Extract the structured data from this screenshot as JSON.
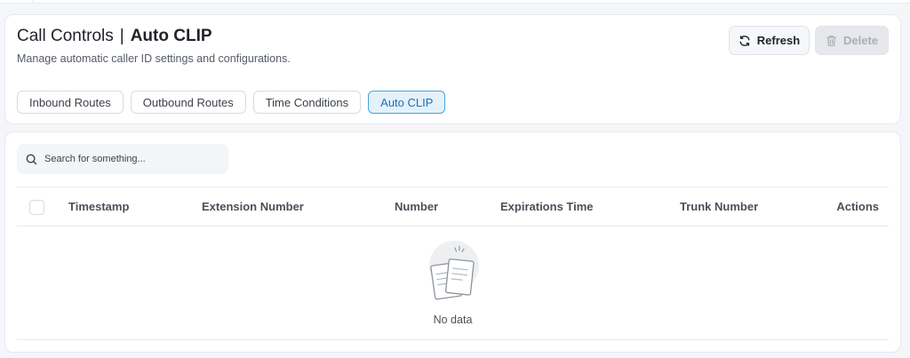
{
  "header": {
    "title": "Call Controls",
    "separator": "|",
    "subtitle": "Auto CLIP",
    "description": "Manage automatic caller ID settings and configurations."
  },
  "actions": {
    "refresh_label": "Refresh",
    "delete_label": "Delete",
    "refresh_icon": "refresh-icon",
    "delete_icon": "trash-icon"
  },
  "tabs": [
    {
      "label": "Inbound Routes",
      "active": false
    },
    {
      "label": "Outbound Routes",
      "active": false
    },
    {
      "label": "Time Conditions",
      "active": false
    },
    {
      "label": "Auto CLIP",
      "active": true
    }
  ],
  "search": {
    "placeholder": "Search for something...",
    "value": ""
  },
  "table": {
    "columns": [
      "Timestamp",
      "Extension Number",
      "Number",
      "Expirations Time",
      "Trunk Number",
      "Actions"
    ],
    "rows": [],
    "empty_text": "No data"
  },
  "colors": {
    "accent": "#4ba3db",
    "active_tab_bg": "#e4f1fb",
    "page_bg": "#f4f6f9"
  }
}
